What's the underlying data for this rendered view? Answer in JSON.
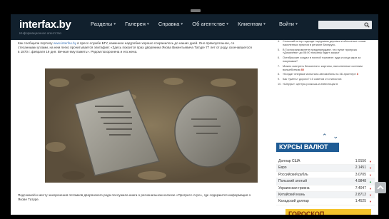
{
  "site": {
    "logo": "interfax.by",
    "tagline": "Информационное агентство"
  },
  "nav": [
    {
      "label": "Разделы"
    },
    {
      "label": "Галерея"
    },
    {
      "label": "Справка"
    },
    {
      "label": "Об агентстве"
    },
    {
      "label": "Клиентам"
    },
    {
      "label": "Войти"
    }
  ],
  "article": {
    "text_before_link": "Как сообщили порталу ",
    "link": "www.interfax.by",
    "text_after_link": " в пресс-службе БГУ, каменное надгробие хорошо сохранилось до наших дней. Оно прямоугольное, со стесанными углами, на нем легко прочитывается эпитафия: «Здесь покоится прах дворянина Якова Викентьевича Татуре 77 лет от роду, скончавшегося в 1870 г. февраля 19 дня. Вечная ему память». Рядом похоронена и его жена.",
    "caption": "Подсказкой к месту захоронения потомков дворянского рода послужила книга о региональном колхозе «Прогресс-Агро», где содержится информация о Якове Татуре."
  },
  "sidebar": {
    "news": [
      {
        "num": "4.",
        "text": "Сельский истор подходит щедлимы деревья и обеспечил голым населенных пунктов в регионе Беларусь"
      },
      {
        "num": "5.",
        "text": "В Госпогранкомитете предупреждают, что пункт пропуска «Домачево» до 08:00 погранш будет закрыт"
      },
      {
        "num": "6.",
        "text": "Октябрьские создал в ночной торговле: куда и когда идти за покупками?"
      },
      {
        "num": "7.",
        "text": "Можно смотреть бесконечно: картины, наполненные осенним волшебством",
        "count": "85"
      },
      {
        "num": "8.",
        "text": "«Конда» впервые испытала автомобиль на 3D-принтере",
        "count": "8"
      },
      {
        "num": "9.",
        "text": "Как «уметь» дорого? 10 советов от стилистов"
      },
      {
        "num": "10.",
        "text": "«Шнуры»: центры роскошь и инвестиции в"
      }
    ],
    "currency_title": "КУРСЫ ВАЛЮТ",
    "rates": [
      {
        "name": "Доллар США",
        "value": "1.9156",
        "trend": "down"
      },
      {
        "name": "Евро",
        "value": "2.1451",
        "trend": "down"
      },
      {
        "name": "Российский рубль",
        "value": "3.0705",
        "trend": "down"
      },
      {
        "name": "Польский злотый",
        "value": "4.9848",
        "trend": "up"
      },
      {
        "name": "Украинская гривна",
        "value": "7.4047",
        "trend": "down"
      },
      {
        "name": "Китайский юань",
        "value": "2.8712",
        "trend": "down"
      },
      {
        "name": "Канадский доллар",
        "value": "1.4525",
        "trend": "down"
      }
    ],
    "horoscope_title": "ГОРОСКОП"
  },
  "colors": {
    "header": "#11202d",
    "link": "#3a73b8",
    "currency_header": "#1f5c95",
    "horoscope": "#f4c42c"
  },
  "icons": [
    "search-icon",
    "chevron-up-icon",
    "chevron-down-icon",
    "scroll-top-icon"
  ]
}
